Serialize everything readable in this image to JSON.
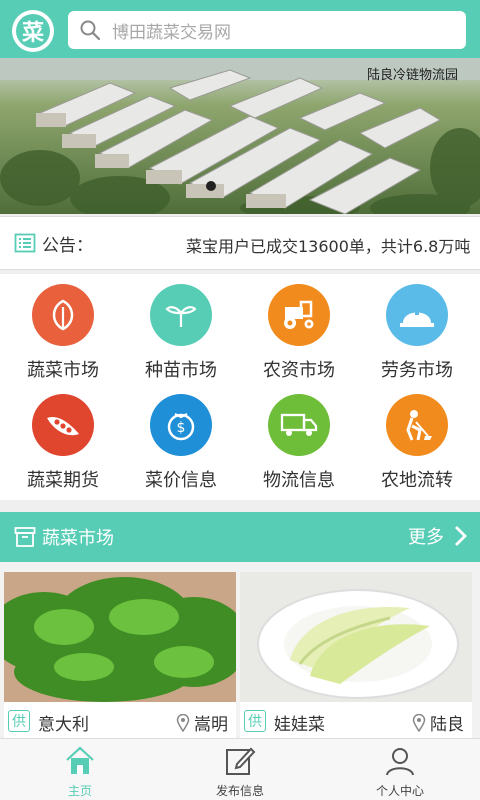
{
  "header": {
    "logo_char": "菜",
    "search_placeholder": "博田蔬菜交易网"
  },
  "banner": {
    "caption": "陆良冷链物流园"
  },
  "notice": {
    "label": "公告：",
    "text": "菜宝用户已成交13600单，共计6.8万吨"
  },
  "services": [
    {
      "label": "蔬菜市场",
      "icon": "leaf-icon",
      "color": "#e8603c"
    },
    {
      "label": "种苗市场",
      "icon": "sprout-icon",
      "color": "#57cdb6"
    },
    {
      "label": "农资市场",
      "icon": "tractor-icon",
      "color": "#f28b1e"
    },
    {
      "label": "劳务市场",
      "icon": "helmet-icon",
      "color": "#5bbbe8"
    },
    {
      "label": "蔬菜期货",
      "icon": "peapod-icon",
      "color": "#e0452e"
    },
    {
      "label": "菜价信息",
      "icon": "price-tomato-icon",
      "color": "#1f8fd8"
    },
    {
      "label": "物流信息",
      "icon": "truck-icon",
      "color": "#6ebe3a"
    },
    {
      "label": "农地流转",
      "icon": "worker-shovel-icon",
      "color": "#f28b1e"
    }
  ],
  "section": {
    "title": "蔬菜市场",
    "more": "更多"
  },
  "products": [
    {
      "tag": "供",
      "name": "意大利",
      "location": "嵩明"
    },
    {
      "tag": "供",
      "name": "娃娃菜",
      "location": "陆良"
    }
  ],
  "nav": [
    {
      "label": "主页",
      "active": true
    },
    {
      "label": "发布信息",
      "active": false
    },
    {
      "label": "个人中心",
      "active": false
    }
  ],
  "colors": {
    "accent": "#57cdb6"
  }
}
